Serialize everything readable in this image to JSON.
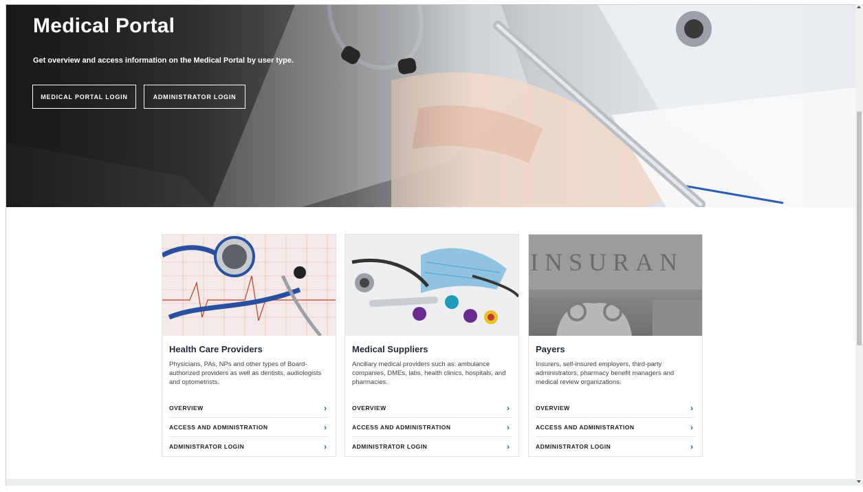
{
  "hero": {
    "title": "Medical Portal",
    "subtitle": "Get overview and access information on the Medical Portal by user type.",
    "buttons": [
      "MEDICAL PORTAL LOGIN",
      "ADMINISTRATOR LOGIN"
    ]
  },
  "cards": [
    {
      "title": "Health Care Providers",
      "description": "Physicians, PAs, NPs and other types of Board-authorized providers as well as dentists, audiologists and optometrists.",
      "links": [
        "OVERVIEW",
        "ACCESS AND ADMINISTRATION",
        "ADMINISTRATOR LOGIN"
      ]
    },
    {
      "title": "Medical Suppliers",
      "description": "Ancillary medical providers such as: ambulance companies, DMEs, labs, health clinics, hospitals, and pharmacies.",
      "links": [
        "OVERVIEW",
        "ACCESS AND ADMINISTRATION",
        "ADMINISTRATOR LOGIN"
      ]
    },
    {
      "title": "Payers",
      "description": "Insurers, self-insured employers, third-party administrators, pharmacy benefit managers and medical review organizations.",
      "links": [
        "OVERVIEW",
        "ACCESS AND ADMINISTRATION",
        "ADMINISTRATOR LOGIN"
      ],
      "image_text": "INSURAN"
    }
  ],
  "icons": {
    "link_chevron": "chevron-right-icon"
  },
  "colors": {
    "accent": "#1a6fa8",
    "hero_text": "#ffffff",
    "footer_band": "#e9efef"
  }
}
